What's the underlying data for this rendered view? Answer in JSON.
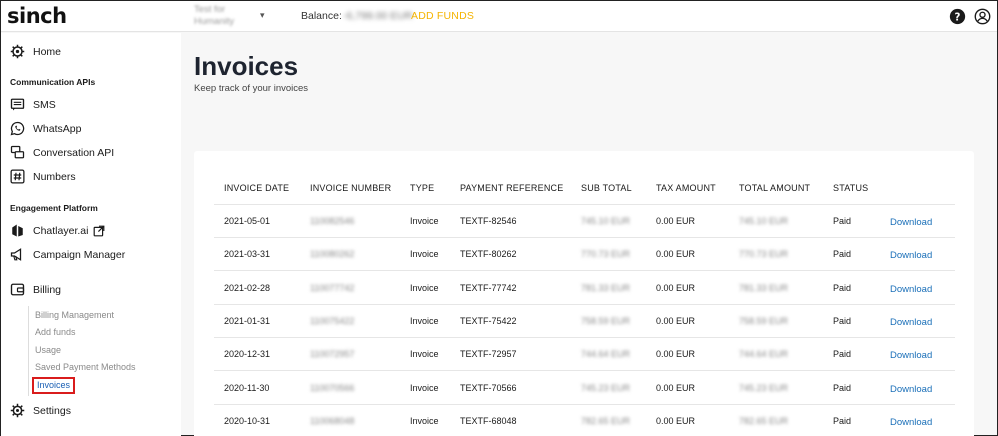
{
  "header": {
    "logo": "sinch",
    "account_name": "Test for Humanity",
    "balance_label": "Balance:",
    "balance_value": "-6,799.00 EUR",
    "add_funds": "ADD FUNDS"
  },
  "sidebar": {
    "home": "Home",
    "section_comm": "Communication APIs",
    "sms": "SMS",
    "whatsapp": "WhatsApp",
    "conversation": "Conversation API",
    "numbers": "Numbers",
    "section_engage": "Engagement Platform",
    "chatlayer": "Chatlayer.ai",
    "campaign": "Campaign Manager",
    "billing": "Billing",
    "billing_items": [
      "Billing Management",
      "Add funds",
      "Usage",
      "Saved Payment Methods",
      "Invoices"
    ],
    "settings": "Settings"
  },
  "main": {
    "title": "Invoices",
    "subtitle": "Keep track of your invoices"
  },
  "table": {
    "headers": [
      "INVOICE DATE",
      "INVOICE NUMBER",
      "TYPE",
      "PAYMENT REFERENCE",
      "SUB TOTAL",
      "TAX AMOUNT",
      "TOTAL AMOUNT",
      "STATUS"
    ],
    "rows": [
      {
        "date": "2021-05-01",
        "number": "110082546",
        "type": "Invoice",
        "ref": "TEXTF-82546",
        "sub": "745.10 EUR",
        "tax": "0.00 EUR",
        "total": "745.10 EUR",
        "status": "Paid",
        "action": "Download"
      },
      {
        "date": "2021-03-31",
        "number": "110080262",
        "type": "Invoice",
        "ref": "TEXTF-80262",
        "sub": "770.73 EUR",
        "tax": "0.00 EUR",
        "total": "770.73 EUR",
        "status": "Paid",
        "action": "Download"
      },
      {
        "date": "2021-02-28",
        "number": "110077742",
        "type": "Invoice",
        "ref": "TEXTF-77742",
        "sub": "781.33 EUR",
        "tax": "0.00 EUR",
        "total": "781.33 EUR",
        "status": "Paid",
        "action": "Download"
      },
      {
        "date": "2021-01-31",
        "number": "110075422",
        "type": "Invoice",
        "ref": "TEXTF-75422",
        "sub": "758.59 EUR",
        "tax": "0.00 EUR",
        "total": "758.59 EUR",
        "status": "Paid",
        "action": "Download"
      },
      {
        "date": "2020-12-31",
        "number": "110072957",
        "type": "Invoice",
        "ref": "TEXTF-72957",
        "sub": "744.64 EUR",
        "tax": "0.00 EUR",
        "total": "744.64 EUR",
        "status": "Paid",
        "action": "Download"
      },
      {
        "date": "2020-11-30",
        "number": "110070566",
        "type": "Invoice",
        "ref": "TEXTF-70566",
        "sub": "745.23 EUR",
        "tax": "0.00 EUR",
        "total": "745.23 EUR",
        "status": "Paid",
        "action": "Download"
      },
      {
        "date": "2020-10-31",
        "number": "110068048",
        "type": "Invoice",
        "ref": "TEXTF-68048",
        "sub": "782.65 EUR",
        "tax": "0.00 EUR",
        "total": "782.65 EUR",
        "status": "Paid",
        "action": "Download"
      }
    ]
  },
  "icons": {
    "help": "help-circle-icon",
    "user": "user-account-icon",
    "home": "gear-home-icon",
    "sms": "message-icon",
    "whatsapp": "whatsapp-icon",
    "conversation": "chat-bubbles-icon",
    "numbers": "hash-icon",
    "chatlayer": "chatlayer-icon",
    "external": "external-link-icon",
    "campaign": "megaphone-icon",
    "billing": "wallet-icon",
    "settings": "gear-icon"
  },
  "colors": {
    "accent_link": "#1a6fb8",
    "add_funds": "#f5b400",
    "highlight_border": "#d91c1c"
  }
}
